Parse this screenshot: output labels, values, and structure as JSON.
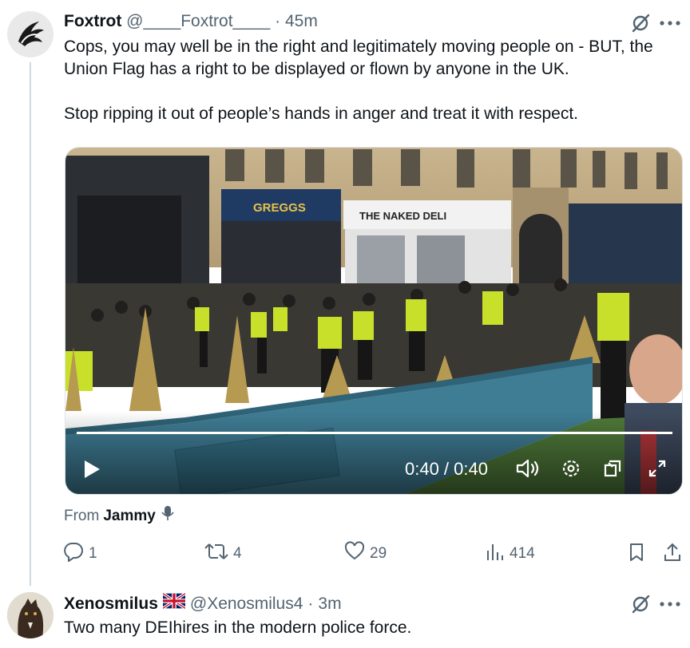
{
  "post": {
    "author_name": "Foxtrot",
    "handle": "@____Foxtrot____",
    "separator": "·",
    "time": "45m",
    "paragraph1": "Cops, you may well be in the right and legitimately moving people on - BUT, the Union Flag has a right to be displayed or flown by anyone in the UK.",
    "paragraph2": "Stop ripping it out of people’s hands in anger and treat it with respect.",
    "video": {
      "shop_sign_1": "GREGGS",
      "shop_sign_2": "THE NAKED DELI",
      "time_display": "0:40 / 0:40",
      "progress": 1.0
    },
    "from_label": "From",
    "from_name": "Jammy",
    "actions": {
      "replies": "1",
      "reposts": "4",
      "likes": "29",
      "views": "414"
    },
    "icons": [
      "grok-icon",
      "more-icon",
      "play-icon",
      "volume-icon",
      "settings-icon",
      "pip-icon",
      "fullscreen-icon",
      "mic-icon",
      "reply-icon",
      "repost-icon",
      "like-icon",
      "views-icon",
      "bookmark-icon",
      "share-icon"
    ]
  },
  "reply": {
    "author_name": "Xenosmilus",
    "handle": "@Xenosmilus4",
    "separator": "·",
    "time": "3m",
    "text": "Two many DEIhires in the modern police force."
  },
  "colors": {
    "text": "#0f1419",
    "secondary": "#536471",
    "thread_line": "#cfd9de"
  }
}
